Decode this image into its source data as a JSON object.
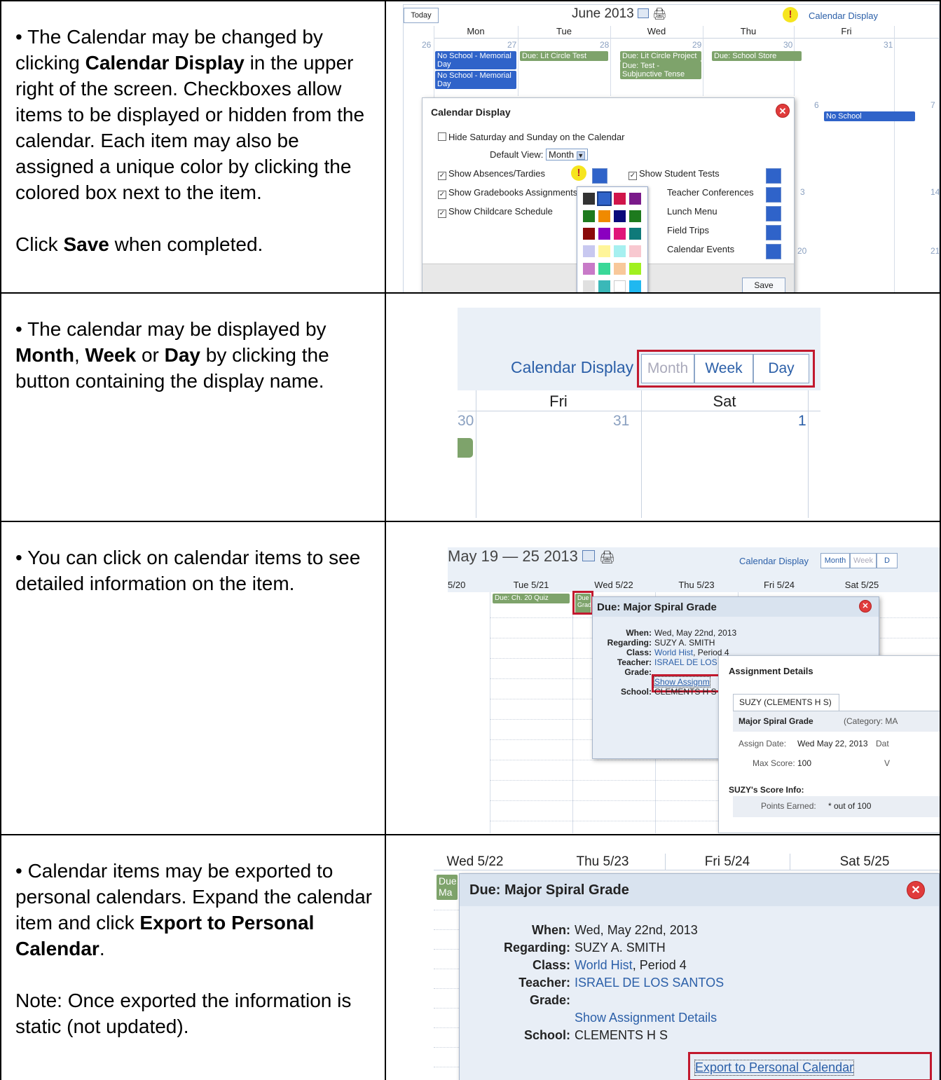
{
  "rows": [
    {
      "bullet_text": "• The Calendar may be changed by clicking ",
      "bold1": "Calendar Display",
      "after1": " in the upper right of the screen. Checkboxes allow items to be displayed or hidden from the calendar.  Each item may also be assigned a unique color by clicking the colored box next to the item.",
      "p2_before": "Click ",
      "p2_bold": "Save",
      "p2_after": " when completed."
    },
    {
      "t1": "• The calendar may be displayed by ",
      "b1": "Month",
      "t2": ", ",
      "b2": "Week",
      "t3": " or ",
      "b3": "Day",
      "t4": " by clicking the button containing the display name."
    },
    {
      "text": "• You can click on calendar items to see detailed information on the item."
    },
    {
      "t1": "• Calendar items may be exported to personal calendars.  Expand the calendar item and click ",
      "b1": "Export to Personal Calendar",
      "t2": ".",
      "note": "Note:  Once exported the information is static (not updated)."
    }
  ],
  "shot1": {
    "today": "Today",
    "title": "June 2013",
    "calendar_display": "Calendar Display",
    "days": [
      "Mon",
      "Tue",
      "Wed",
      "Thu",
      "Fri"
    ],
    "daynums": [
      "26",
      "27",
      "28",
      "29",
      "30",
      "31"
    ],
    "events": {
      "mon1": "No School - Memorial Day",
      "mon2": "No School - Memorial Day",
      "tue": "Due: Lit Circle Test",
      "wed1": "Due: Lit Circle Project",
      "wed2": "Due: Test - Subjunctive Tense",
      "thu": "Due: School Store",
      "fri": "No School"
    },
    "side_nums": [
      "6",
      "7",
      "3",
      "14",
      "20",
      "21"
    ],
    "dialog": {
      "title": "Calendar Display",
      "hide_weekend": "Hide Saturday and Sunday on the Calendar",
      "default_view_label": "Default View:",
      "default_view": "Month",
      "items_left": [
        "Show Absences/Tardies",
        "Show Gradebooks Assignments",
        "Show Childcare Schedule"
      ],
      "items_right": [
        "Show Student Tests",
        "Teacher Conferences",
        "Lunch Menu",
        "Field Trips",
        "Calendar Events"
      ],
      "save": "Save"
    },
    "palette": [
      "#333333",
      "#2f63c9",
      "#d0154a",
      "#7a1a8a",
      "#1e7a1e",
      "#f08a00",
      "#0a0a7a",
      "#1e7a1e",
      "#8a0a0a",
      "#8a00c0",
      "#e0157a",
      "#0f7a7a",
      "#c8c8f0",
      "#fff59a",
      "#a6f0f0",
      "#f8c8d0",
      "#c87ac8",
      "#3ad898",
      "#f8c89a",
      "#a0f020",
      "#e0e0e0",
      "#3ab8b8",
      "#ffffff",
      "#20b8f0"
    ]
  },
  "shot2": {
    "calendar_display": "Calendar Display",
    "buttons": [
      "Month",
      "Week",
      "Day"
    ],
    "days": [
      "Fri",
      "Sat"
    ],
    "nums": [
      "30",
      "31",
      "1"
    ]
  },
  "shot3": {
    "title": "May 19 — 25 2013",
    "calendar_display": "Calendar Display",
    "buttons": [
      "Month",
      "Week",
      "D"
    ],
    "days": [
      "5/20",
      "Tue 5/21",
      "Wed 5/22",
      "Thu 5/23",
      "Fri 5/24",
      "Sat 5/25"
    ],
    "ev1": "Due: Ch. 20 Quiz",
    "ev2": "Due Grad",
    "popup": {
      "title": "Due: Major Spiral Grade",
      "labels": [
        "When:",
        "Regarding:",
        "Class:",
        "Teacher:",
        "Grade:",
        "School:"
      ],
      "when": "Wed, May 22nd, 2013",
      "regarding": "SUZY A. SMITH",
      "class_link": "World Hist",
      "class_rest": ", Period 4",
      "teacher": "ISRAEL DE LOS SANTOS",
      "show_assign": "Show Assignm",
      "school": "CLEMENTS H S"
    },
    "details": {
      "title": "Assignment Details",
      "tab": "SUZY (CLEMENTS H S)",
      "name": "Major Spiral Grade",
      "category": "(Category: MA",
      "assign_label": "Assign Date:",
      "assign_val": "Wed May 22, 2013",
      "dat": "Dat",
      "max_label": "Max Score:",
      "max_val": "100",
      "w": "V",
      "score_head": "SUZY's Score Info:",
      "points_label": "Points Earned:",
      "points_val": "* out of 100"
    }
  },
  "shot4": {
    "days": [
      "Wed 5/22",
      "Thu 5/23",
      "Fri 5/24",
      "Sat 5/25"
    ],
    "ev": "Due: Ma Grade",
    "popup": {
      "title": "Due: Major Spiral Grade",
      "labels": [
        "When:",
        "Regarding:",
        "Class:",
        "Teacher:",
        "Grade:",
        "School:"
      ],
      "when": "Wed, May 22nd, 2013",
      "regarding": "SUZY A. SMITH",
      "class_link": "World Hist",
      "class_rest": ", Period 4",
      "teacher": "ISRAEL DE LOS SANTOS",
      "show_assign": "Show Assignment Details",
      "school": "CLEMENTS H S",
      "export": "Export to Personal Calendar"
    }
  }
}
